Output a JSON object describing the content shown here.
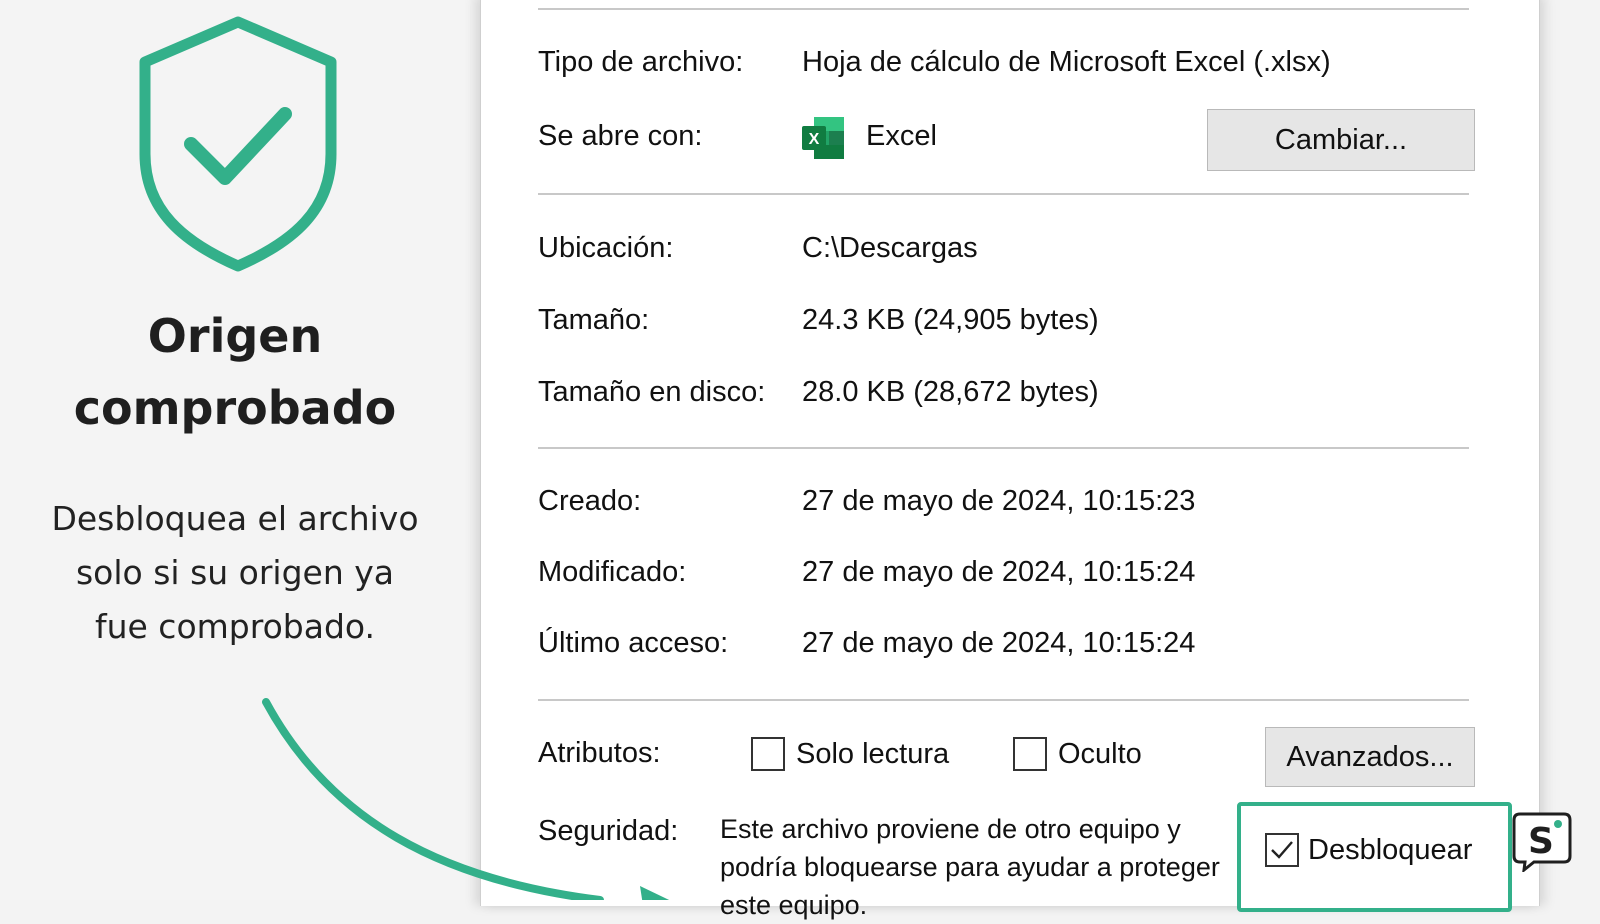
{
  "promo": {
    "title_line1": "Origen",
    "title_line2": "comprobado",
    "description_line1": "Desbloquea el archivo",
    "description_line2": "solo si su origen ya",
    "description_line3": "fue comprobado.",
    "icon": "shield-check-icon",
    "accent_color": "#33b08a"
  },
  "properties": {
    "file_type_label": "Tipo de archivo:",
    "file_type_value": "Hoja de cálculo de Microsoft Excel (.xlsx)",
    "opens_with_label": "Se abre con:",
    "opens_with_value": "Excel",
    "change_button": "Cambiar...",
    "location_label": "Ubicación:",
    "location_value": "C:\\Descargas",
    "size_label": "Tamaño:",
    "size_value": "24.3 KB (24,905 bytes)",
    "size_on_disk_label": "Tamaño en disco:",
    "size_on_disk_value": "28.0 KB (28,672 bytes)",
    "created_label": "Creado:",
    "created_value": "27 de mayo de 2024, 10:15:23",
    "modified_label": "Modificado:",
    "modified_value": "27 de mayo de 2024, 10:15:24",
    "accessed_label": "Último acceso:",
    "accessed_value": "27 de mayo de 2024, 10:15:24",
    "attributes_label": "Atributos:",
    "readonly_label": "Solo lectura",
    "readonly_checked": false,
    "hidden_label": "Oculto",
    "hidden_checked": false,
    "advanced_button": "Avanzados...",
    "security_label": "Seguridad:",
    "security_line1": "Este archivo proviene de otro equipo y",
    "security_line2": "podría bloquearse para ayudar a proteger",
    "security_line3": "este equipo.",
    "unblock_label": "Desbloquear",
    "unblock_checked": true
  },
  "excel_icon": {
    "letter": "X",
    "color": "#1d7a45"
  },
  "logo": {
    "letter": "S"
  }
}
